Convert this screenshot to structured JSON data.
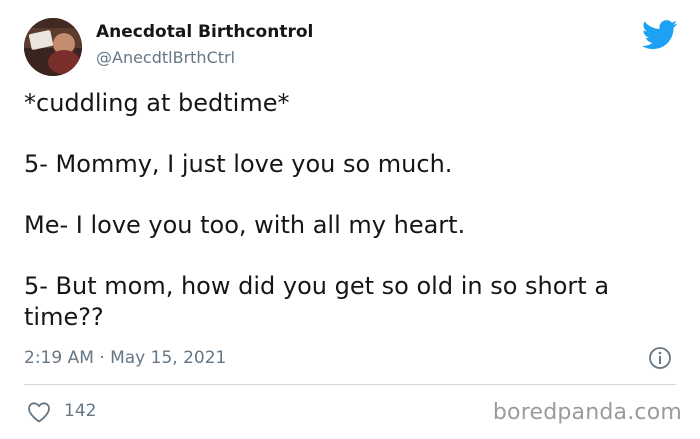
{
  "author": {
    "name": "Anecdotal Birthcontrol",
    "handle": "@AnecdtlBrthCtrl"
  },
  "tweet": {
    "lines": [
      "*cuddling at bedtime*",
      "5- Mommy, I just love you so much.",
      "Me- I love you too, with all my heart.",
      "5- But mom, how did you get so old in so short a time??"
    ],
    "timestamp": "2:19 AM · May 15, 2021",
    "likes": "142"
  },
  "icons": {
    "brand": "twitter-bird-icon",
    "info": "info-icon",
    "like": "heart-icon"
  },
  "colors": {
    "twitter_blue": "#1da1f2",
    "secondary_text": "#657786"
  },
  "watermark": "boredpanda.com"
}
